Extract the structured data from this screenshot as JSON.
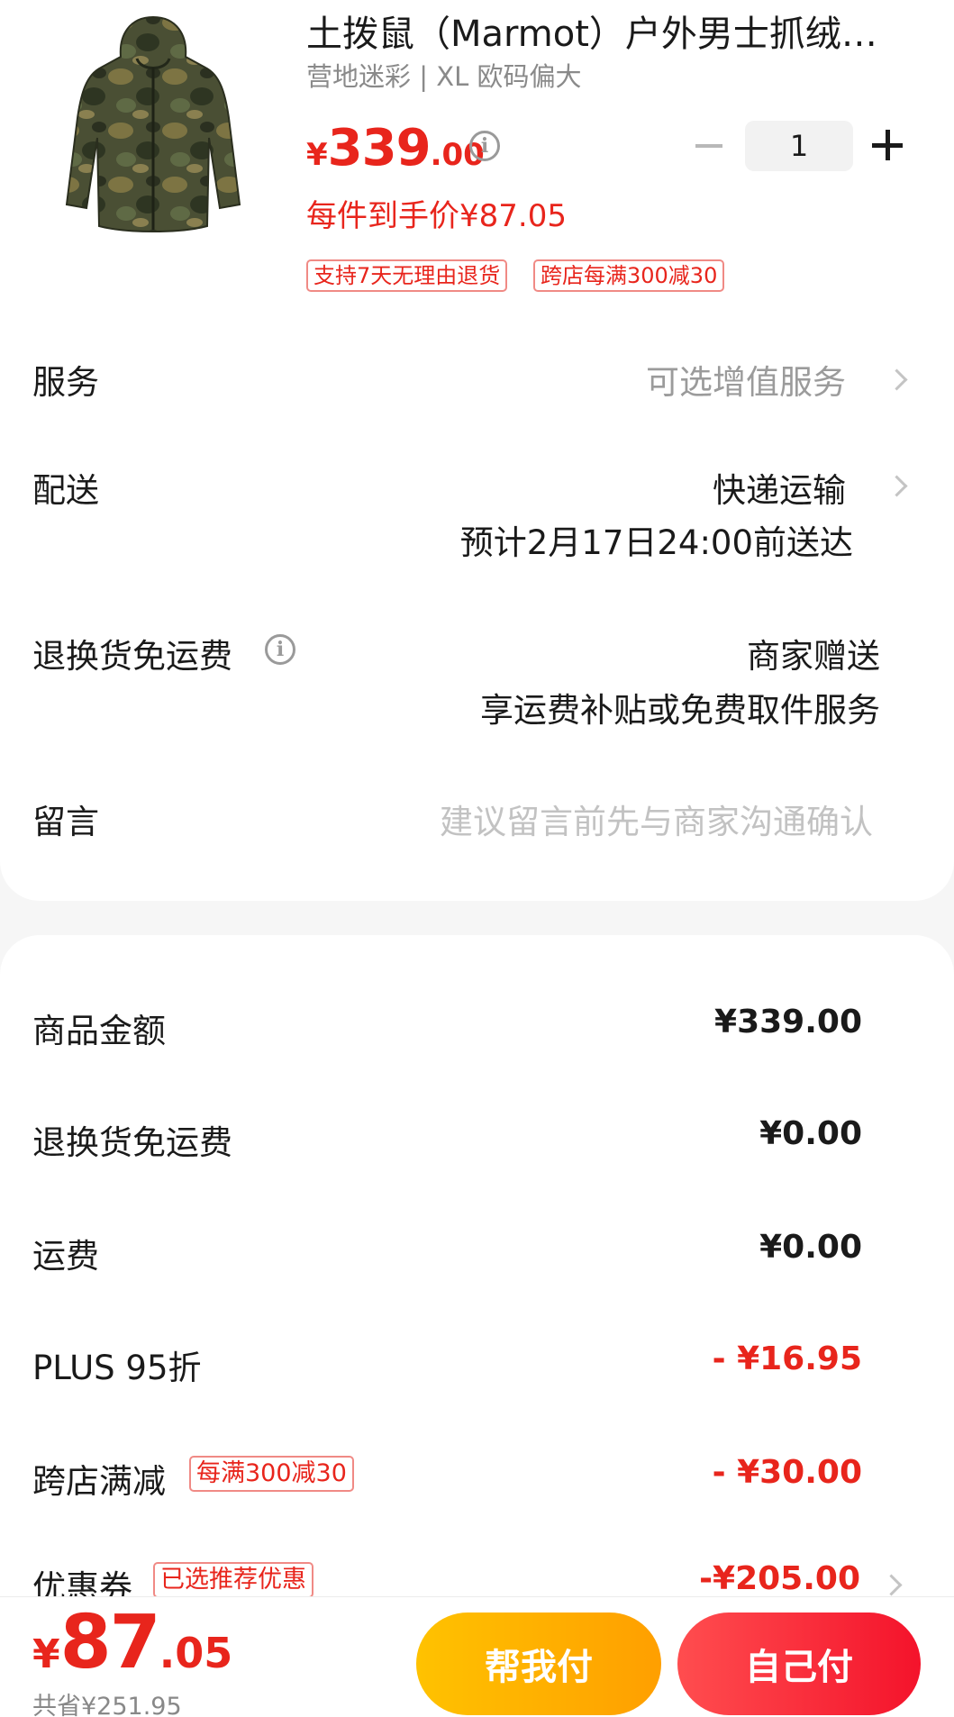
{
  "product": {
    "title": "土拨鼠（Marmot）户外男士抓绒衣...",
    "variant": "营地迷彩 | XL 欧码偏大",
    "price_currency": "¥",
    "price_integer": "339",
    "price_decimal": ".00",
    "per_item_price": "每件到手价¥87.05",
    "quantity": "1",
    "tags": [
      "支持7天无理由退货",
      "跨店每满300减30"
    ]
  },
  "rows": {
    "service": {
      "label": "服务",
      "value": "可选增值服务"
    },
    "delivery": {
      "label": "配送",
      "value": "快递运输",
      "eta": "预计2月17日24:00前送达"
    },
    "return_freight": {
      "label": "退换货免运费",
      "value": "商家赠送",
      "detail": "享运费补贴或免费取件服务"
    },
    "message": {
      "label": "留言",
      "placeholder": "建议留言前先与商家沟通确认"
    }
  },
  "summary": {
    "goods_amount": {
      "label": "商品金额",
      "value": "¥339.00"
    },
    "return_freight": {
      "label": "退换货免运费",
      "value": "¥0.00"
    },
    "shipping": {
      "label": "运费",
      "value": "¥0.00"
    },
    "plus_discount": {
      "label": "PLUS 95折",
      "value": "- ¥16.95"
    },
    "cross_store": {
      "label": "跨店满减",
      "tag": "每满300减30",
      "value": "- ¥30.00"
    },
    "coupon": {
      "label": "优惠券",
      "tag": "已选推荐优惠",
      "value": "-¥205.00"
    }
  },
  "footer": {
    "total_currency": "¥",
    "total_integer": "87",
    "total_decimal": ".05",
    "saved": "共省¥251.95",
    "help_pay_label": "帮我付",
    "self_pay_label": "自己付"
  },
  "colors": {
    "accent_red": "#e8251c",
    "help_btn": "#ffb300",
    "pay_btn": "#f62f3c"
  }
}
